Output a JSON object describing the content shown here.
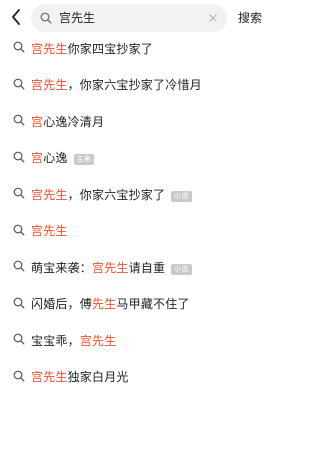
{
  "header": {
    "back_icon": "chevron-left-icon",
    "search_icon": "search-icon",
    "query": "宫先生",
    "clear_icon": "close-icon",
    "search_button": "搜索"
  },
  "colors": {
    "highlight": "#e8532f",
    "badge_bg": "#c9c9c9",
    "search_bg": "#f2f2f2"
  },
  "suggestions": [
    {
      "parts": [
        {
          "t": "宫先生",
          "hl": true
        },
        {
          "t": "你家四宝抄家了",
          "hl": false
        }
      ],
      "badge": ""
    },
    {
      "parts": [
        {
          "t": "宫先生",
          "hl": true
        },
        {
          "t": "，你家六宝抄家了冷惜月",
          "hl": false
        }
      ],
      "badge": ""
    },
    {
      "parts": [
        {
          "t": "宫",
          "hl": true
        },
        {
          "t": "心逸冷清月",
          "hl": false
        }
      ],
      "badge": ""
    },
    {
      "parts": [
        {
          "t": "宫",
          "hl": true
        },
        {
          "t": "心逸",
          "hl": false
        }
      ],
      "badge": "主角"
    },
    {
      "parts": [
        {
          "t": "宫先生",
          "hl": true
        },
        {
          "t": "，你家六宝抄家了",
          "hl": false
        }
      ],
      "badge": "小说"
    },
    {
      "parts": [
        {
          "t": "宫先生",
          "hl": true
        }
      ],
      "badge": ""
    },
    {
      "parts": [
        {
          "t": "萌宝来袭：",
          "hl": false
        },
        {
          "t": "宫先生",
          "hl": true
        },
        {
          "t": "请自重",
          "hl": false
        }
      ],
      "badge": "小说"
    },
    {
      "parts": [
        {
          "t": "闪婚后，傅",
          "hl": false
        },
        {
          "t": "先生",
          "hl": true
        },
        {
          "t": "马甲藏不住了",
          "hl": false
        }
      ],
      "badge": ""
    },
    {
      "parts": [
        {
          "t": "宝宝乖，",
          "hl": false
        },
        {
          "t": "宫先生",
          "hl": true
        }
      ],
      "badge": ""
    },
    {
      "parts": [
        {
          "t": "宫先生",
          "hl": true
        },
        {
          "t": "独家白月光",
          "hl": false
        }
      ],
      "badge": ""
    }
  ]
}
